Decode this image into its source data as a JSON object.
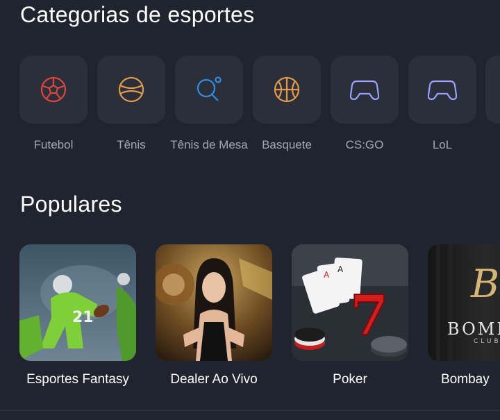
{
  "sections": {
    "categories_title": "Categorias de esportes",
    "popular_title": "Populares"
  },
  "categories": [
    {
      "label": "Futebol",
      "icon": "soccer-ball-icon",
      "color": "#e0453f"
    },
    {
      "label": "Tênis",
      "icon": "tennis-ball-icon",
      "color": "#e49a4c"
    },
    {
      "label": "Tênis de Mesa",
      "icon": "table-tennis-icon",
      "color": "#2f8fe0"
    },
    {
      "label": "Basquete",
      "icon": "basketball-icon",
      "color": "#e49a4c"
    },
    {
      "label": "CS:GO",
      "icon": "gamepad-icon",
      "color": "#9aa0ff"
    },
    {
      "label": "LoL",
      "icon": "gamepad-icon",
      "color": "#9aa0ff"
    }
  ],
  "popular": [
    {
      "label": "Esportes Fantasy",
      "thumb": "football-player-image"
    },
    {
      "label": "Dealer Ao Vivo",
      "thumb": "live-dealer-image"
    },
    {
      "label": "Poker",
      "thumb": "poker-cards-image"
    },
    {
      "label": "Bombay",
      "thumb": "bombay-club-logo",
      "logo_text": "BOMB",
      "logo_sub": "CLUB"
    }
  ]
}
